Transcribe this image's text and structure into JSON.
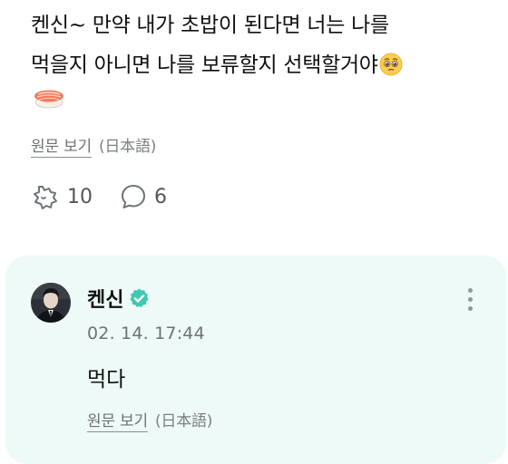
{
  "post": {
    "line1": "켄신~ 만약 내가 초밥이 된다면 너는 나를",
    "line2": "먹을지 아니면 나를 보류할지 선택할거야",
    "emoji_pleading": "pleading-face-emoji",
    "emoji_sushi": "sushi-emoji",
    "translate_label": "원문 보기",
    "translate_lang": "(日本語)",
    "like_count": "10",
    "comment_count": "6"
  },
  "reply": {
    "author": "켄신",
    "verified_icon": "verified-badge-icon",
    "timestamp": "02. 14. 17:44",
    "text": "먹다",
    "translate_label": "원문 보기",
    "translate_lang": "(日本語)",
    "card_color": "#eefaf7",
    "badge_color": "#3fc9b0"
  }
}
